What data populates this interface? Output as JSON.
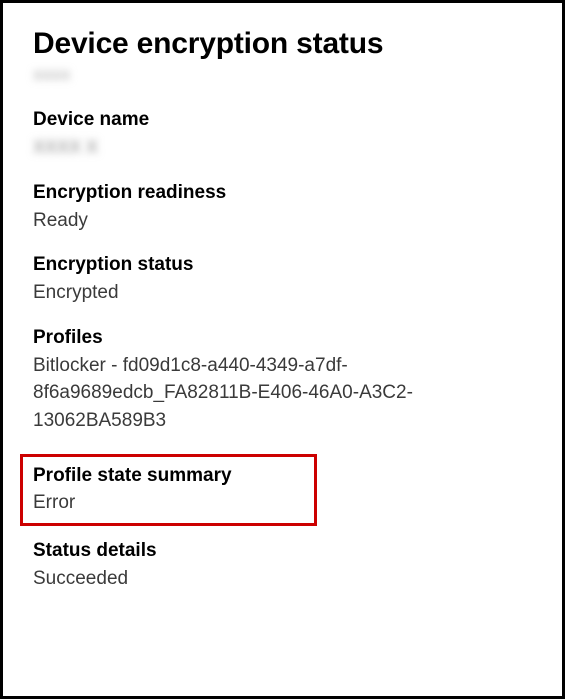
{
  "title": "Device encryption status",
  "subtitle_obscured": "XXXX",
  "fields": {
    "deviceName": {
      "label": "Device name",
      "value_obscured": "XXXX X"
    },
    "encryptionReadiness": {
      "label": "Encryption readiness",
      "value": "Ready"
    },
    "encryptionStatus": {
      "label": "Encryption status",
      "value": "Encrypted"
    },
    "profiles": {
      "label": "Profiles",
      "value": "Bitlocker - fd09d1c8-a440-4349-a7df-8f6a9689edcb_FA82811B-E406-46A0-A3C2-13062BA589B3"
    },
    "profileStateSummary": {
      "label": "Profile state summary",
      "value": "Error"
    },
    "statusDetails": {
      "label": "Status details",
      "value": "Succeeded"
    }
  }
}
